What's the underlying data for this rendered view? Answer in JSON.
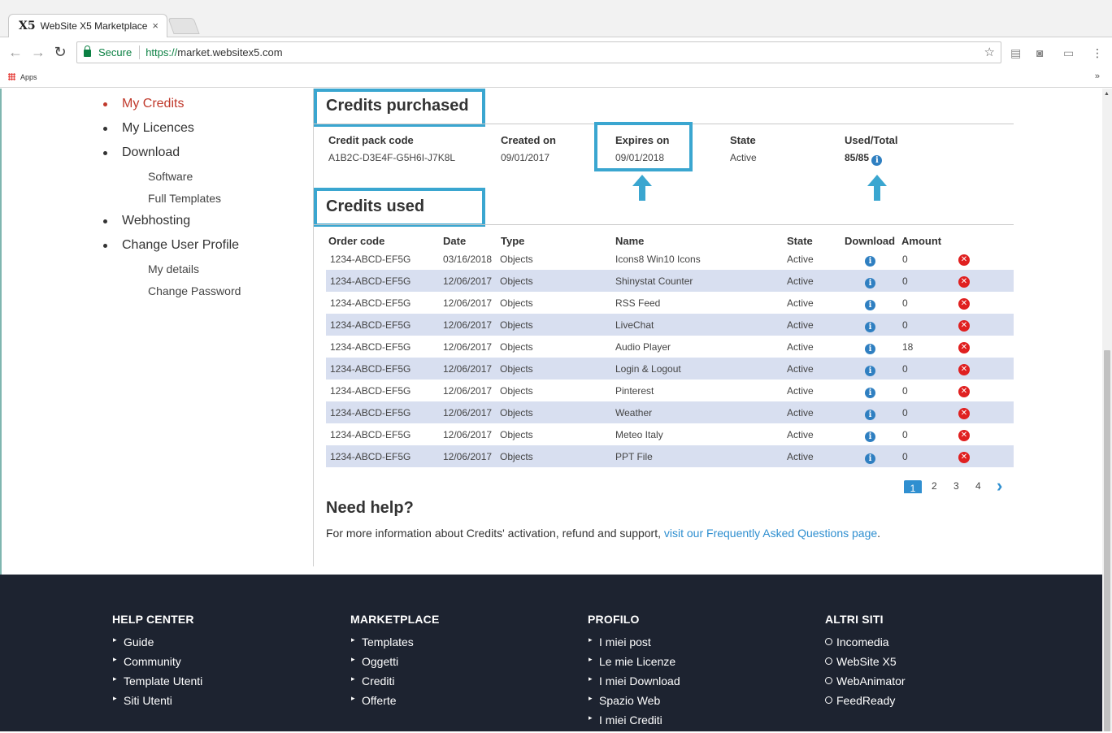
{
  "browser": {
    "tab_title": "WebSite X5 Marketplace",
    "tab_close": "×",
    "secure_label": "Secure",
    "url_scheme": "https://",
    "url_host": "market.websitex5.com",
    "bookmarks_apps": "Apps",
    "bookmarks_more": "»"
  },
  "sidebar": {
    "items": [
      {
        "label": "My Credits",
        "active": true
      },
      {
        "label": "My Licences"
      },
      {
        "label": "Download"
      },
      {
        "label": "Webhosting"
      },
      {
        "label": "Change User Profile"
      }
    ],
    "download_sub": [
      "Software",
      "Full Templates"
    ],
    "profile_sub": [
      "My details",
      "Change Password"
    ]
  },
  "purchased": {
    "title": "Credits purchased",
    "headers": {
      "code": "Credit pack code",
      "created": "Created on",
      "expires": "Expires on",
      "state": "State",
      "used": "Used/Total"
    },
    "row": {
      "code": "A1B2C-D3E4F-G5H6I-J7K8L",
      "created": "09/01/2017",
      "expires": "09/01/2018",
      "state": "Active",
      "used": "85/85"
    }
  },
  "used": {
    "title": "Credits used",
    "headers": {
      "order": "Order code",
      "date": "Date",
      "type": "Type",
      "name": "Name",
      "state": "State",
      "download": "Download",
      "amount": "Amount"
    },
    "rows": [
      {
        "order": "1234-ABCD-EF5G",
        "date": "03/16/2018",
        "type": "Objects",
        "name": "Icons8 Win10 Icons",
        "state": "Active",
        "amount": "0"
      },
      {
        "order": "1234-ABCD-EF5G",
        "date": "12/06/2017",
        "type": "Objects",
        "name": "Shinystat Counter",
        "state": "Active",
        "amount": "0"
      },
      {
        "order": "1234-ABCD-EF5G",
        "date": "12/06/2017",
        "type": "Objects",
        "name": "RSS Feed",
        "state": "Active",
        "amount": "0"
      },
      {
        "order": "1234-ABCD-EF5G",
        "date": "12/06/2017",
        "type": "Objects",
        "name": "LiveChat",
        "state": "Active",
        "amount": "0"
      },
      {
        "order": "1234-ABCD-EF5G",
        "date": "12/06/2017",
        "type": "Objects",
        "name": "Audio Player",
        "state": "Active",
        "amount": "18"
      },
      {
        "order": "1234-ABCD-EF5G",
        "date": "12/06/2017",
        "type": "Objects",
        "name": "Login & Logout",
        "state": "Active",
        "amount": "0"
      },
      {
        "order": "1234-ABCD-EF5G",
        "date": "12/06/2017",
        "type": "Objects",
        "name": "Pinterest",
        "state": "Active",
        "amount": "0"
      },
      {
        "order": "1234-ABCD-EF5G",
        "date": "12/06/2017",
        "type": "Objects",
        "name": "Weather",
        "state": "Active",
        "amount": "0"
      },
      {
        "order": "1234-ABCD-EF5G",
        "date": "12/06/2017",
        "type": "Objects",
        "name": "Meteo Italy",
        "state": "Active",
        "amount": "0"
      },
      {
        "order": "1234-ABCD-EF5G",
        "date": "12/06/2017",
        "type": "Objects",
        "name": "PPT File",
        "state": "Active",
        "amount": "0"
      }
    ]
  },
  "pagination": {
    "pages": [
      "1",
      "2",
      "3",
      "4"
    ],
    "current": "1",
    "next": "›"
  },
  "help": {
    "title": "Need help?",
    "text": "For more information about Credits' activation, refund and support, ",
    "link": "visit our Frequently Asked Questions page",
    "end": "."
  },
  "footer": {
    "columns": [
      {
        "title": "HELP CENTER",
        "links": [
          "Guide",
          "Community",
          "Template Utenti",
          "Siti Utenti"
        ],
        "marker": "chevron"
      },
      {
        "title": "MARKETPLACE",
        "links": [
          "Templates",
          "Oggetti",
          "Crediti",
          "Offerte"
        ],
        "marker": "chevron"
      },
      {
        "title": "PROFILO",
        "links": [
          "I miei post",
          "Le mie Licenze",
          "I miei Download",
          "Spazio Web",
          "I miei Crediti"
        ],
        "marker": "chevron"
      },
      {
        "title": "ALTRI SITI",
        "links": [
          "Incomedia",
          "WebSite X5",
          "WebAnimator",
          "FeedReady"
        ],
        "marker": "ring"
      }
    ]
  },
  "colors": {
    "accent": "#2f8fd0",
    "highlight": "#3aa6d0",
    "active_menu": "#c0392b",
    "row_alt": "#d8dff0",
    "footer_bg": "#1d2330"
  }
}
